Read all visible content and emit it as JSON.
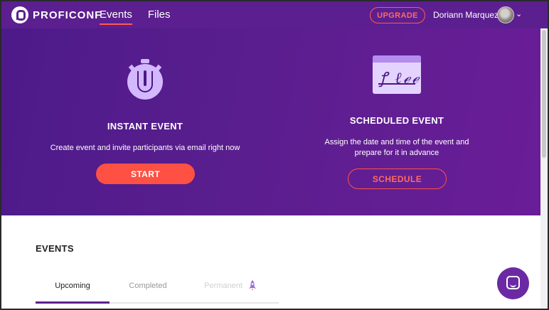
{
  "header": {
    "brand": "PROFICONF",
    "nav": [
      {
        "label": "Events",
        "active": true
      },
      {
        "label": "Files",
        "active": false
      }
    ],
    "upgrade_label": "UPGRADE",
    "user_name": "Doriann Marquez",
    "chevron": "⌄"
  },
  "hero": {
    "instant": {
      "title": "INSTANT EVENT",
      "description": "Create event and invite participants via email right now",
      "button": "START",
      "icon": "stopwatch-icon"
    },
    "scheduled": {
      "title": "SCHEDULED EVENT",
      "description_line1": "Assign the date and time of the event and",
      "description_line2": "prepare for it in advance",
      "button": "SCHEDULE",
      "icon": "signature-calendar-icon"
    }
  },
  "events": {
    "title": "EVENTS",
    "tabs": [
      {
        "label": "Upcoming",
        "active": true
      },
      {
        "label": "Completed",
        "active": false
      },
      {
        "label": "Permanent",
        "active": false,
        "disabled": true
      }
    ]
  },
  "colors": {
    "header_bg": "#5c1f8f",
    "hero_bg": "#5a1e8e",
    "accent": "#ff5143",
    "tab_active": "#5c1f8f",
    "chat_bg": "#6b2aa3"
  },
  "chat": {
    "icon": "chat-icon"
  }
}
